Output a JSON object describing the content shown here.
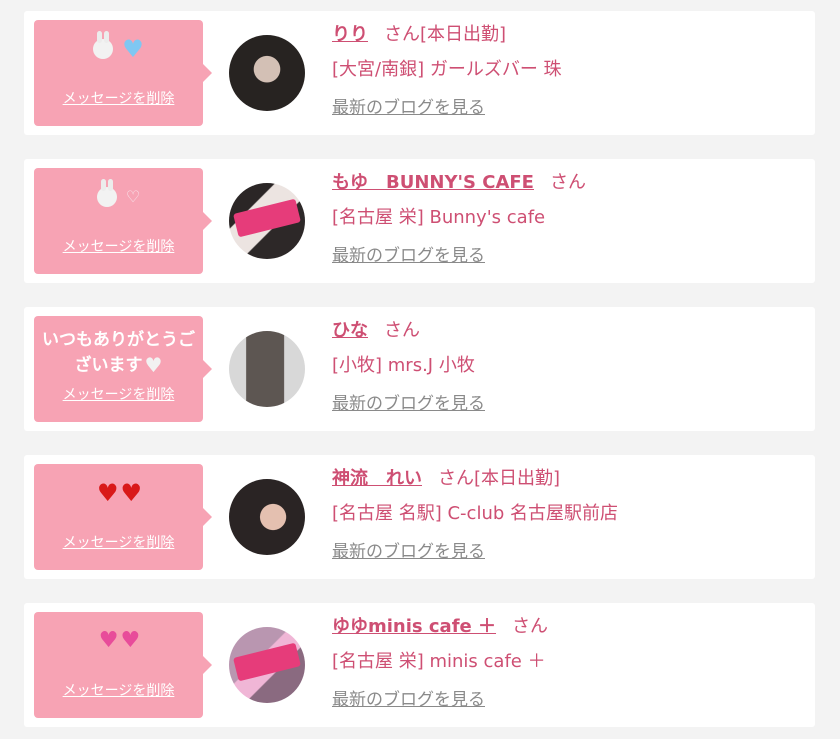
{
  "cards": [
    {
      "message": "",
      "delete_label": "メッセージを削除",
      "name": "りり",
      "honorific": "さん",
      "status": "[本日出勤]",
      "shop": "[大宮/南銀] ガールズバー 珠",
      "blog": "最新のブログを見る"
    },
    {
      "message": "",
      "delete_label": "メッセージを削除",
      "name": "もゆ　BUNNY'S CAFE",
      "honorific": "さん",
      "status": "",
      "shop": "[名古屋 栄] Bunny's cafe",
      "blog": "最新のブログを見る"
    },
    {
      "message": "いつもありがとうございます",
      "delete_label": "メッセージを削除",
      "name": "ひな",
      "honorific": "さん",
      "status": "",
      "shop": "[小牧] mrs.J 小牧",
      "blog": "最新のブログを見る"
    },
    {
      "message": "",
      "delete_label": "メッセージを削除",
      "name": "神流　れい",
      "honorific": "さん",
      "status": "[本日出勤]",
      "shop": "[名古屋 名駅] C-club 名古屋駅前店",
      "blog": "最新のブログを見る"
    },
    {
      "message": "",
      "delete_label": "メッセージを削除",
      "name": "ゆゆminis cafe ＋",
      "honorific": "さん",
      "status": "",
      "shop": "[名古屋 栄] minis cafe ＋",
      "blog": "最新のブログを見る"
    }
  ],
  "icons": {
    "bunny": "rabbit-face-icon",
    "blue_heart": "blue-heart-icon",
    "white_heart": "white-heart-icon",
    "red_heart": "red-heart-icon",
    "pink_hearts": "two-hearts-icon"
  },
  "colors": {
    "page_background": "#f3f3f3",
    "card_background": "#ffffff",
    "bubble_background": "#f7a3b4",
    "accent_text": "#ce4f73",
    "link_gray": "#8a8a8a"
  }
}
